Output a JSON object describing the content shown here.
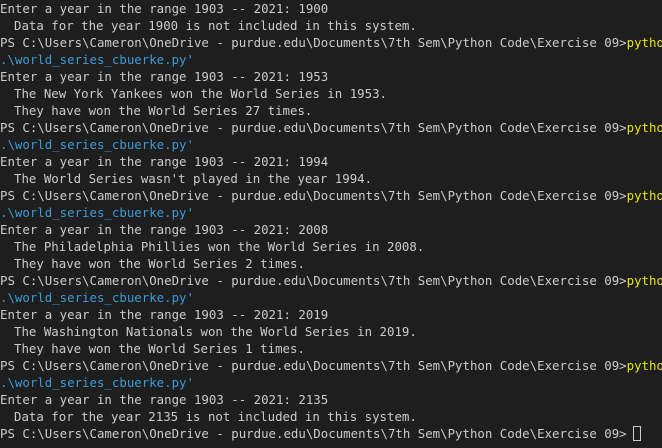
{
  "terminal": {
    "prompt_path": "PS C:\\Users\\Cameron\\OneDrive - purdue.edu\\Documents\\7th Sem\\Python Code\\Exercise 09>",
    "command": "python",
    "quote_open": "'",
    "script_arg": ".\\world_series_cbuerke.py'",
    "lines": {
      "l1": "Enter a year in the range 1903 -- 2021: 1900",
      "l2": "Data for the year 1900 is not included in this system.",
      "l5": "Enter a year in the range 1903 -- 2021: 1953",
      "l6": "The New York Yankees won the World Series in 1953.",
      "l7": "They have won the World Series 27 times.",
      "l10": "Enter a year in the range 1903 -- 2021: 1994",
      "l11": "The World Series wasn't played in the year 1994.",
      "l14": "Enter a year in the range 1903 -- 2021: 2008",
      "l15": "The Philadelphia Phillies won the World Series in 2008.",
      "l16": "They have won the World Series 2 times.",
      "l19": "Enter a year in the range 1903 -- 2021: 2019",
      "l20": "The Washington Nationals won the World Series in 2019.",
      "l21": "They have won the World Series 1 times.",
      "l24": "Enter a year in the range 1903 -- 2021: 2135",
      "l25": "Data for the year 2135 is not included in this system."
    }
  }
}
